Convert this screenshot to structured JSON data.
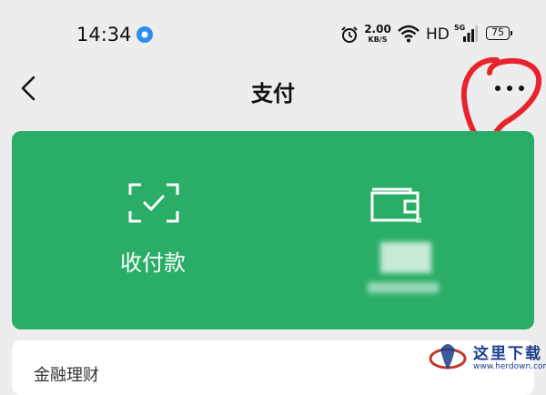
{
  "status_bar": {
    "time": "14:34",
    "net_speed_value": "2.00",
    "net_speed_unit": "KB/S",
    "network_label": "HD",
    "signal_label": "5G",
    "battery_level": "75"
  },
  "nav": {
    "title": "支付",
    "back_icon": "chevron-left-icon",
    "more_icon": "more-horizontal-icon"
  },
  "pay_card": {
    "background_color": "#2aae67",
    "receive_label": "收付款",
    "receive_icon": "scan-check-icon",
    "wallet_icon": "wallet-icon"
  },
  "finance": {
    "title": "金融理财"
  },
  "annotation": {
    "color": "#e8232e"
  },
  "watermark": {
    "title": "这里下载",
    "url": "www.herdown.com"
  }
}
